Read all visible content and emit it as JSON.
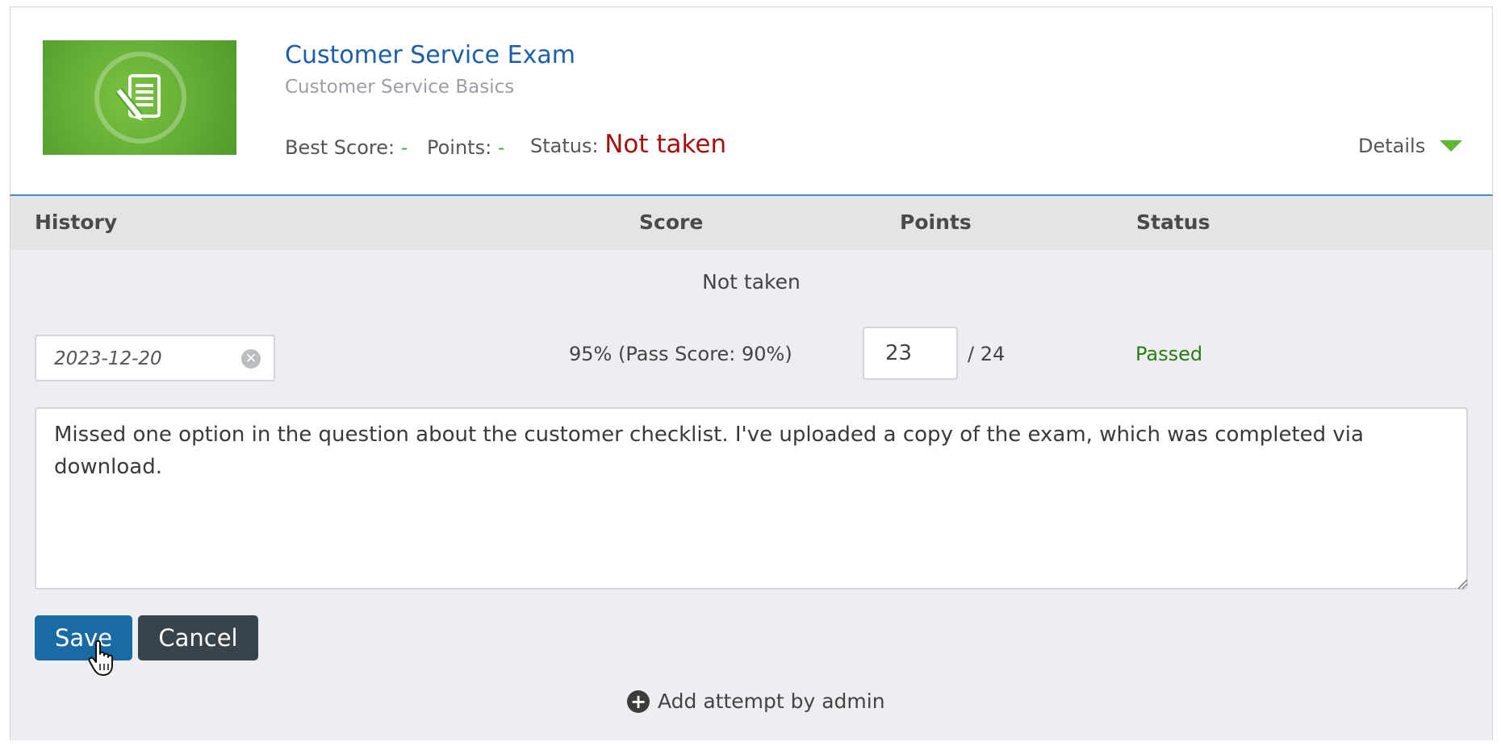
{
  "course": {
    "title": "Customer Service Exam",
    "subtitle": "Customer Service Basics",
    "thumbnail_icon": "exam-document-pen-icon",
    "accent_color": "#5aa832"
  },
  "summary": {
    "best_score_label": "Best Score:",
    "best_score_value": "-",
    "points_label": "Points:",
    "points_value": "-",
    "status_label": "Status:",
    "status_value": "Not taken",
    "status_color": "#a50f0f"
  },
  "details_toggle": {
    "label": "Details",
    "icon": "triangle-down-icon"
  },
  "history_table": {
    "columns": [
      "History",
      "Score",
      "Points",
      "Status"
    ],
    "empty_message": "Not taken"
  },
  "edit_attempt": {
    "date_value": "2023-12-20",
    "score_text": "95% (Pass Score: 90%)",
    "points_value": "23",
    "points_max": "/ 24",
    "status": "Passed",
    "status_color": "#2d7a14",
    "notes": "Missed one option in the question about the customer checklist. I've uploaded a copy of the exam, which was completed via download."
  },
  "actions": {
    "save_label": "Save",
    "cancel_label": "Cancel",
    "save_color": "#1a6ba4",
    "cancel_color": "#39434b"
  },
  "add_attempt": {
    "label": "Add attempt by admin",
    "icon": "plus-circle-icon"
  }
}
